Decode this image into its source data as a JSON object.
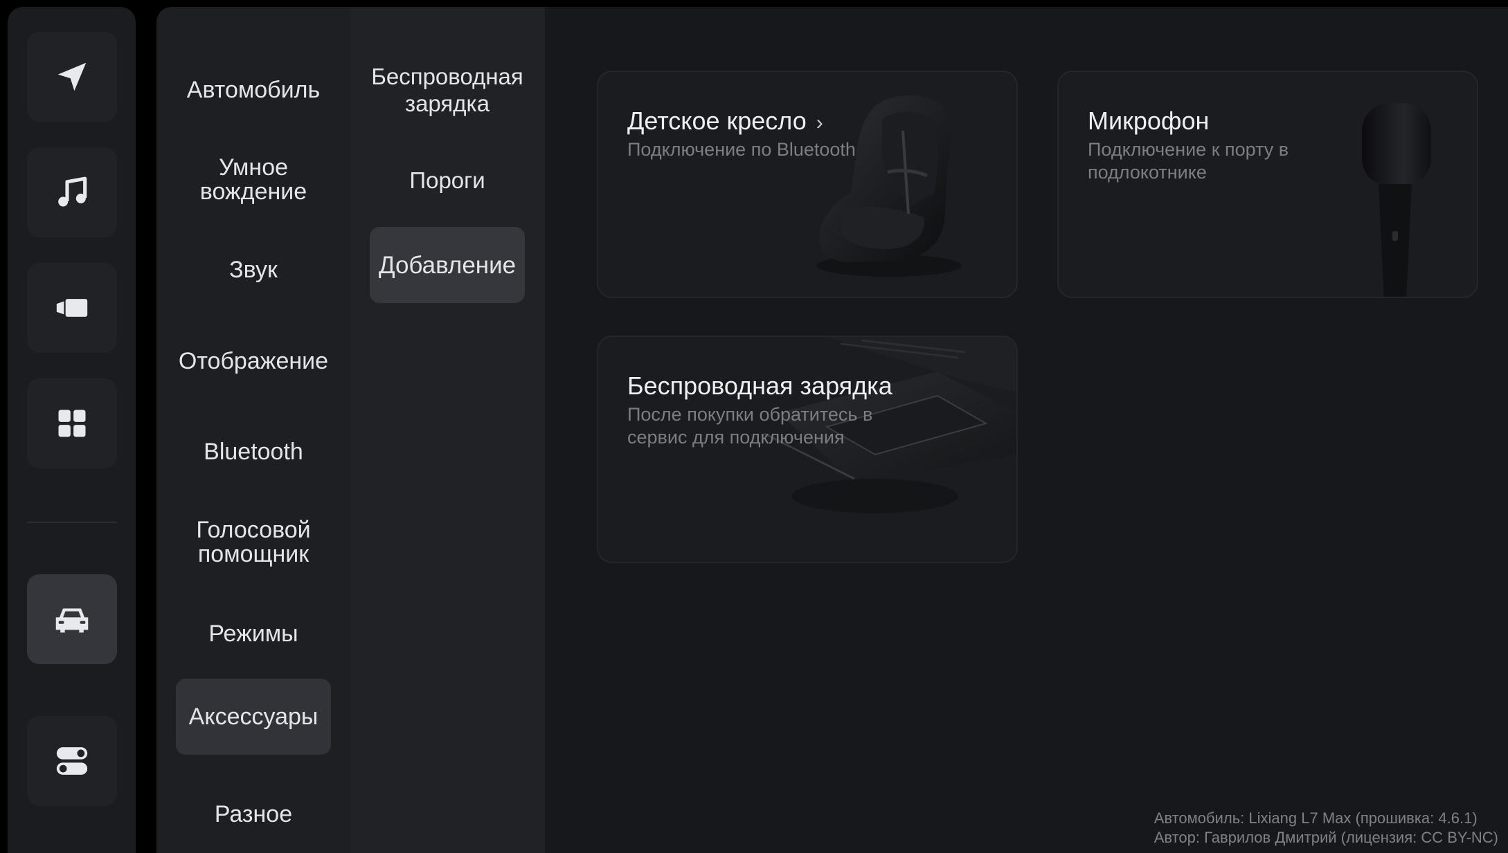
{
  "rail": {
    "buttons": [
      {
        "icon": "navigation-icon"
      },
      {
        "icon": "music-note-icon"
      },
      {
        "icon": "video-camera-icon"
      },
      {
        "icon": "apps-grid-icon"
      },
      {
        "icon": "car-icon",
        "active": true
      },
      {
        "icon": "toggles-icon"
      }
    ]
  },
  "categories": [
    {
      "label": "Автомобиль"
    },
    {
      "label": "Умное вождение"
    },
    {
      "label": "Звук"
    },
    {
      "label": "Отображение"
    },
    {
      "label": "Bluetooth"
    },
    {
      "label": "Голосовой помощник"
    },
    {
      "label": "Режимы"
    },
    {
      "label": "Аксессуары",
      "active": true
    },
    {
      "label": "Разное"
    }
  ],
  "subcategories": [
    {
      "label": "Беспроводная зарядка"
    },
    {
      "label": "Пороги"
    },
    {
      "label": "Добавление",
      "active": true
    }
  ],
  "cards": [
    {
      "title": "Детское кресло",
      "has_chevron": true,
      "chevron": "›",
      "description": "Подключение по Bluetooth",
      "image": "child-seat"
    },
    {
      "title": "Микрофон",
      "has_chevron": false,
      "description": "Подключение к порту в подлокотнике",
      "image": "microphone"
    },
    {
      "title": "Беспроводная зарядка",
      "has_chevron": false,
      "description": "После покупки обратитесь в сервис для подключения",
      "image": "wireless-charger"
    }
  ],
  "footer": {
    "line1": "Автомобиль: Lixiang L7 Max (прошивка: 4.6.1)",
    "line2": "Автор: Гаврилов Дмитрий (лицензия: CC BY-NC)"
  },
  "colors": {
    "background": "#17181b",
    "panel": "#1e1f23",
    "active_item": "#313338",
    "text_primary": "#e4e5e8",
    "text_secondary": "#7b7e85"
  }
}
